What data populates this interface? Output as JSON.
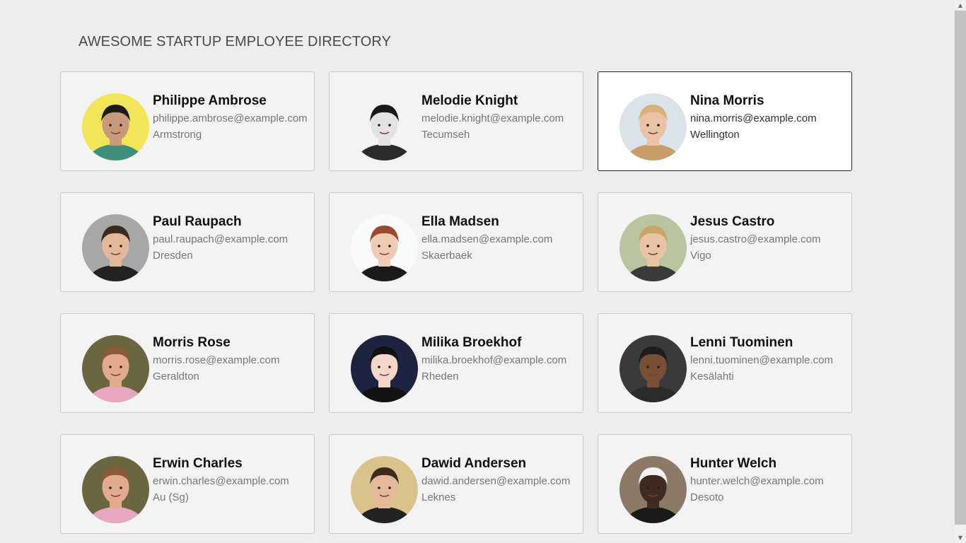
{
  "header": {
    "title": "AWESOME STARTUP EMPLOYEE DIRECTORY"
  },
  "employees": [
    {
      "name": "Philippe Ambrose",
      "email": "philippe.ambrose@example.com",
      "city": "Armstrong",
      "avatar_bg": "#f2e55a",
      "skin": "#c99a7a",
      "hair": "#1c1a1a",
      "shirt": "#3f8f80"
    },
    {
      "name": "Melodie Knight",
      "email": "melodie.knight@example.com",
      "city": "Tecumseh",
      "avatar_bg": "#f4f4f4",
      "skin": "#e3e3e3",
      "hair": "#1a1a1a",
      "shirt": "#2b2b2b"
    },
    {
      "name": "Nina Morris",
      "email": "nina.morris@example.com",
      "city": "Wellington",
      "avatar_bg": "#d9e3ea",
      "skin": "#eac2a6",
      "hair": "#d9b07a",
      "shirt": "#c89d6a"
    },
    {
      "name": "Paul Raupach",
      "email": "paul.raupach@example.com",
      "city": "Dresden",
      "avatar_bg": "#a7a7a7",
      "skin": "#e2b79a",
      "hair": "#3b2a1f",
      "shirt": "#222222"
    },
    {
      "name": "Ella Madsen",
      "email": "ella.madsen@example.com",
      "city": "Skaerbaek",
      "avatar_bg": "#fafafa",
      "skin": "#f0cbb4",
      "hair": "#9a4a2e",
      "shirt": "#1a1a1a"
    },
    {
      "name": "Jesus Castro",
      "email": "jesus.castro@example.com",
      "city": "Vigo",
      "avatar_bg": "#b9c5a0",
      "skin": "#e8c3a4",
      "hair": "#c9a566",
      "shirt": "#3a3a3a"
    },
    {
      "name": "Morris Rose",
      "email": "morris.rose@example.com",
      "city": "Geraldton",
      "avatar_bg": "#6b6540",
      "skin": "#e2ab8e",
      "hair": "#8a5a3a",
      "shirt": "#e8a7c0"
    },
    {
      "name": "Milika Broekhof",
      "email": "milika.broekhof@example.com",
      "city": "Rheden",
      "avatar_bg": "#1d2440",
      "skin": "#f3d6c9",
      "hair": "#111111",
      "shirt": "#131313"
    },
    {
      "name": "Lenni Tuominen",
      "email": "lenni.tuominen@example.com",
      "city": "Kesälahti",
      "avatar_bg": "#3a3a3a",
      "skin": "#7a4f37",
      "hair": "#1d1d1d",
      "shirt": "#2b2b2b"
    },
    {
      "name": "Erwin Charles",
      "email": "erwin.charles@example.com",
      "city": "Au (Sg)",
      "avatar_bg": "#6b6540",
      "skin": "#e2ab8e",
      "hair": "#8a5a3a",
      "shirt": "#e8a7c0"
    },
    {
      "name": "Dawid Andersen",
      "email": "dawid.andersen@example.com",
      "city": "Leknes",
      "avatar_bg": "#d9c38a",
      "skin": "#e4b89a",
      "hair": "#3b2a1f",
      "shirt": "#222222"
    },
    {
      "name": "Hunter Welch",
      "email": "hunter.welch@example.com",
      "city": "Desoto",
      "avatar_bg": "#8a7a66",
      "skin": "#3d2a20",
      "hair": "#f2f2f2",
      "shirt": "#1a1a1a"
    }
  ],
  "selected_index": 2
}
